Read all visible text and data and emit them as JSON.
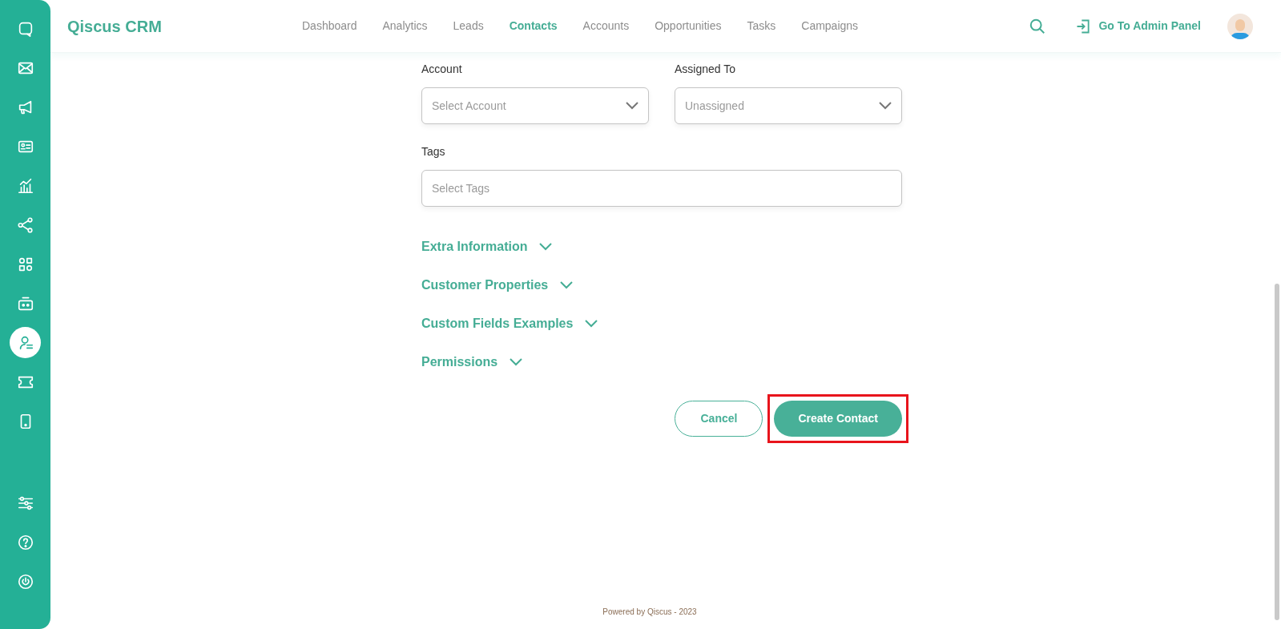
{
  "sidebar": {
    "items": [
      {
        "kind": "chat",
        "selected": false
      },
      {
        "kind": "mail",
        "selected": false
      },
      {
        "kind": "megaphone",
        "selected": false
      },
      {
        "kind": "card",
        "selected": false
      },
      {
        "kind": "chart",
        "selected": false
      },
      {
        "kind": "share",
        "selected": false
      },
      {
        "kind": "apps",
        "selected": false
      },
      {
        "kind": "robot",
        "selected": false
      },
      {
        "kind": "agent",
        "selected": true
      },
      {
        "kind": "ticket",
        "selected": false
      },
      {
        "kind": "phone",
        "selected": false
      }
    ],
    "bottom_items": [
      {
        "kind": "sliders"
      },
      {
        "kind": "help"
      },
      {
        "kind": "power"
      }
    ]
  },
  "header": {
    "brand": "Qiscus CRM",
    "nav": [
      {
        "label": "Dashboard",
        "selected": false
      },
      {
        "label": "Analytics",
        "selected": false
      },
      {
        "label": "Leads",
        "selected": false
      },
      {
        "label": "Contacts",
        "selected": true
      },
      {
        "label": "Accounts",
        "selected": false
      },
      {
        "label": "Opportunities",
        "selected": false
      },
      {
        "label": "Tasks",
        "selected": false
      },
      {
        "label": "Campaigns",
        "selected": false
      }
    ],
    "admin_link": "Go To Admin Panel"
  },
  "form": {
    "fields": [
      {
        "label": "Account",
        "placeholder": "Select Account",
        "kind": "select"
      },
      {
        "label": "Assigned To",
        "placeholder": "Unassigned",
        "kind": "select"
      },
      {
        "label": "Tags",
        "placeholder": "Select Tags",
        "kind": "tags"
      }
    ],
    "sections": [
      {
        "title": "Extra Information",
        "expanded": false
      },
      {
        "title": "Customer Properties",
        "expanded": false
      },
      {
        "title": "Custom Fields Examples",
        "expanded": false
      },
      {
        "title": "Permissions",
        "expanded": false
      }
    ],
    "buttons": [
      {
        "label": "Cancel",
        "kind": "secondary",
        "highlighted": false
      },
      {
        "label": "Create Contact",
        "kind": "primary",
        "highlighted": true
      }
    ]
  },
  "footer": "Powered by Qiscus - 2023"
}
